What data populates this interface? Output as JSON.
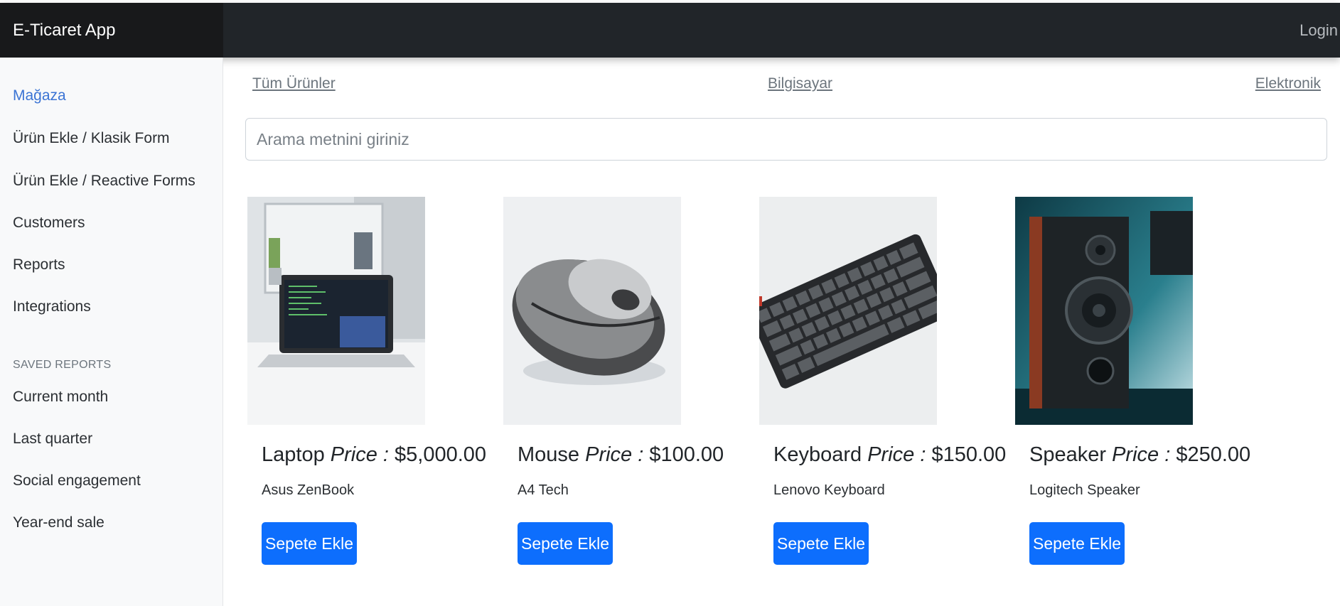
{
  "navbar": {
    "brand": "E-Ticaret App",
    "login_label": "Login"
  },
  "sidebar": {
    "items": [
      "Mağaza",
      "Ürün Ekle / Klasik Form",
      "Ürün Ekle / Reactive Forms",
      "Customers",
      "Reports",
      "Integrations"
    ],
    "active_item": "Mağaza",
    "saved_heading": "SAVED REPORTS",
    "saved_items": [
      "Current month",
      "Last quarter",
      "Social engagement",
      "Year-end sale"
    ]
  },
  "categories": [
    "Tüm Ürünler",
    "Bilgisayar",
    "Elektronik"
  ],
  "search": {
    "placeholder": "Arama metnini giriniz",
    "value": ""
  },
  "price_label": "Price :",
  "button_label": "Sepete Ekle",
  "products": [
    {
      "name": "Laptop",
      "price": "$5,000.00",
      "description": "Asus ZenBook",
      "image": "laptop-photo"
    },
    {
      "name": "Mouse",
      "price": "$100.00",
      "description": "A4 Tech",
      "image": "mouse-photo"
    },
    {
      "name": "Keyboard",
      "price": "$150.00",
      "description": "Lenovo Keyboard",
      "image": "keyboard-photo"
    },
    {
      "name": "Speaker",
      "price": "$250.00",
      "description": "Logitech Speaker",
      "image": "speaker-photo"
    }
  ],
  "colors": {
    "navbar": "#212529",
    "brand_bg": "#18191b",
    "primary": "#0d6efd",
    "active_link": "#3b74d4",
    "sidebar_bg": "#f8f9fa"
  }
}
